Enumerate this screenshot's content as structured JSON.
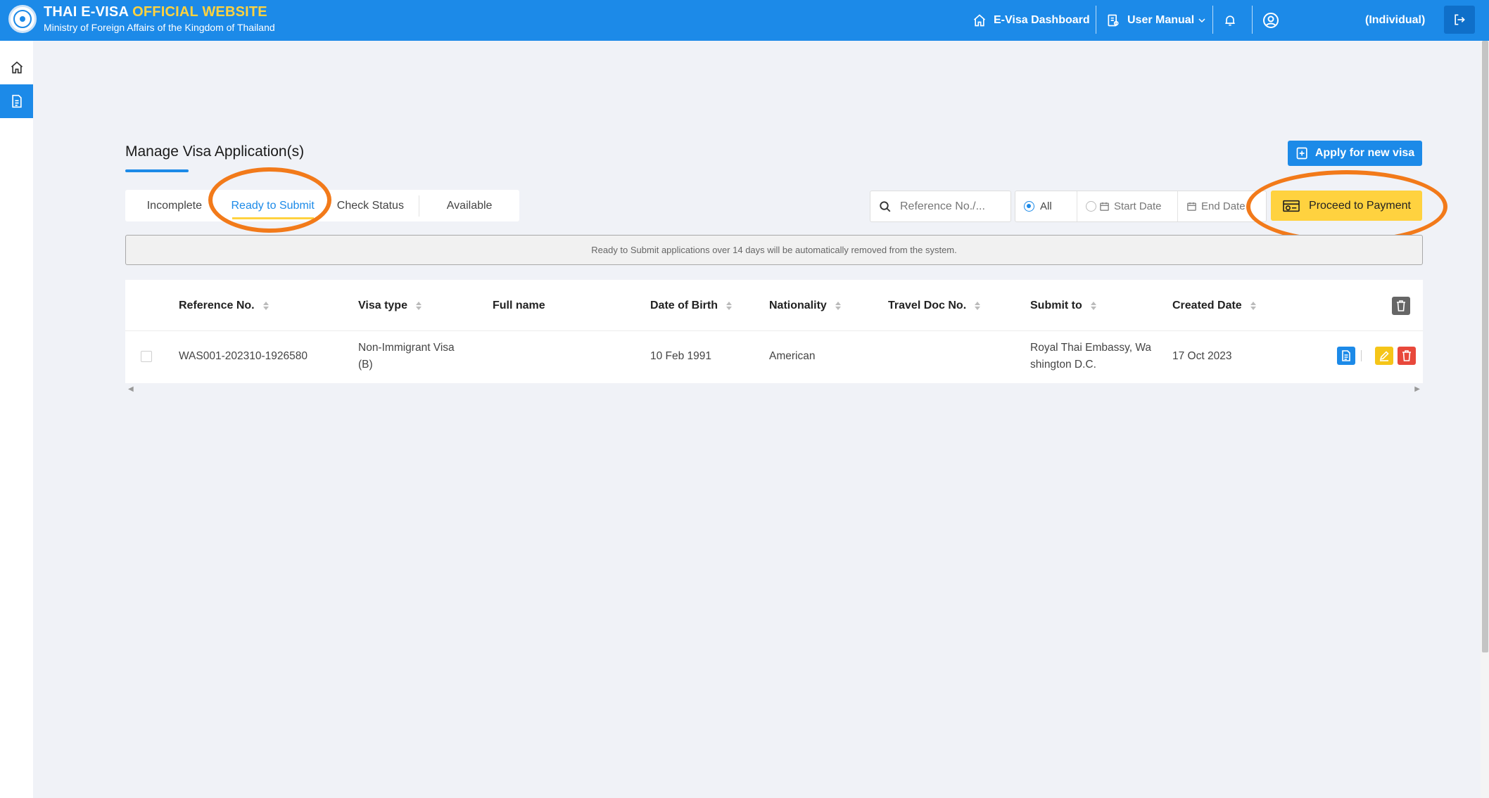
{
  "header": {
    "title_main": "THAI E-VISA",
    "title_accent": "OFFICIAL WEBSITE",
    "subtitle": "Ministry of Foreign Affairs of the Kingdom of Thailand",
    "nav": {
      "dashboard": "E-Visa Dashboard",
      "manual": "User Manual",
      "account_type": "(Individual)"
    }
  },
  "page": {
    "title": "Manage Visa Application(s)",
    "apply_button": "Apply for new visa",
    "tabs": [
      "Incomplete",
      "Ready to Submit",
      "Check Status",
      "Available"
    ],
    "active_tab": "Ready to Submit",
    "search_placeholder": "Reference No./...",
    "filters": {
      "all": "All",
      "start_date": "Start Date",
      "end_date": "End Date"
    },
    "proceed_button": "Proceed to Payment",
    "notice": "Ready to Submit applications over 14 days will be automatically removed from the system."
  },
  "table": {
    "columns": [
      "Reference No.",
      "Visa type",
      "Full name",
      "Date of Birth",
      "Nationality",
      "Travel Doc No.",
      "Submit to",
      "Created Date"
    ],
    "rows": [
      {
        "reference": "WAS001-202310-1926580",
        "visa_type": "Non-Immigrant Visa (B)",
        "full_name": "",
        "dob": "10 Feb 1991",
        "nationality": "American",
        "travel_doc": "",
        "submit_to": "Royal Thai Embassy, Washington D.C.",
        "created": "17 Oct 2023"
      }
    ]
  },
  "colors": {
    "primary": "#1c8ae8",
    "accent": "#ffd23f",
    "highlight_ring": "#f27a1a",
    "danger": "#e8483b"
  }
}
